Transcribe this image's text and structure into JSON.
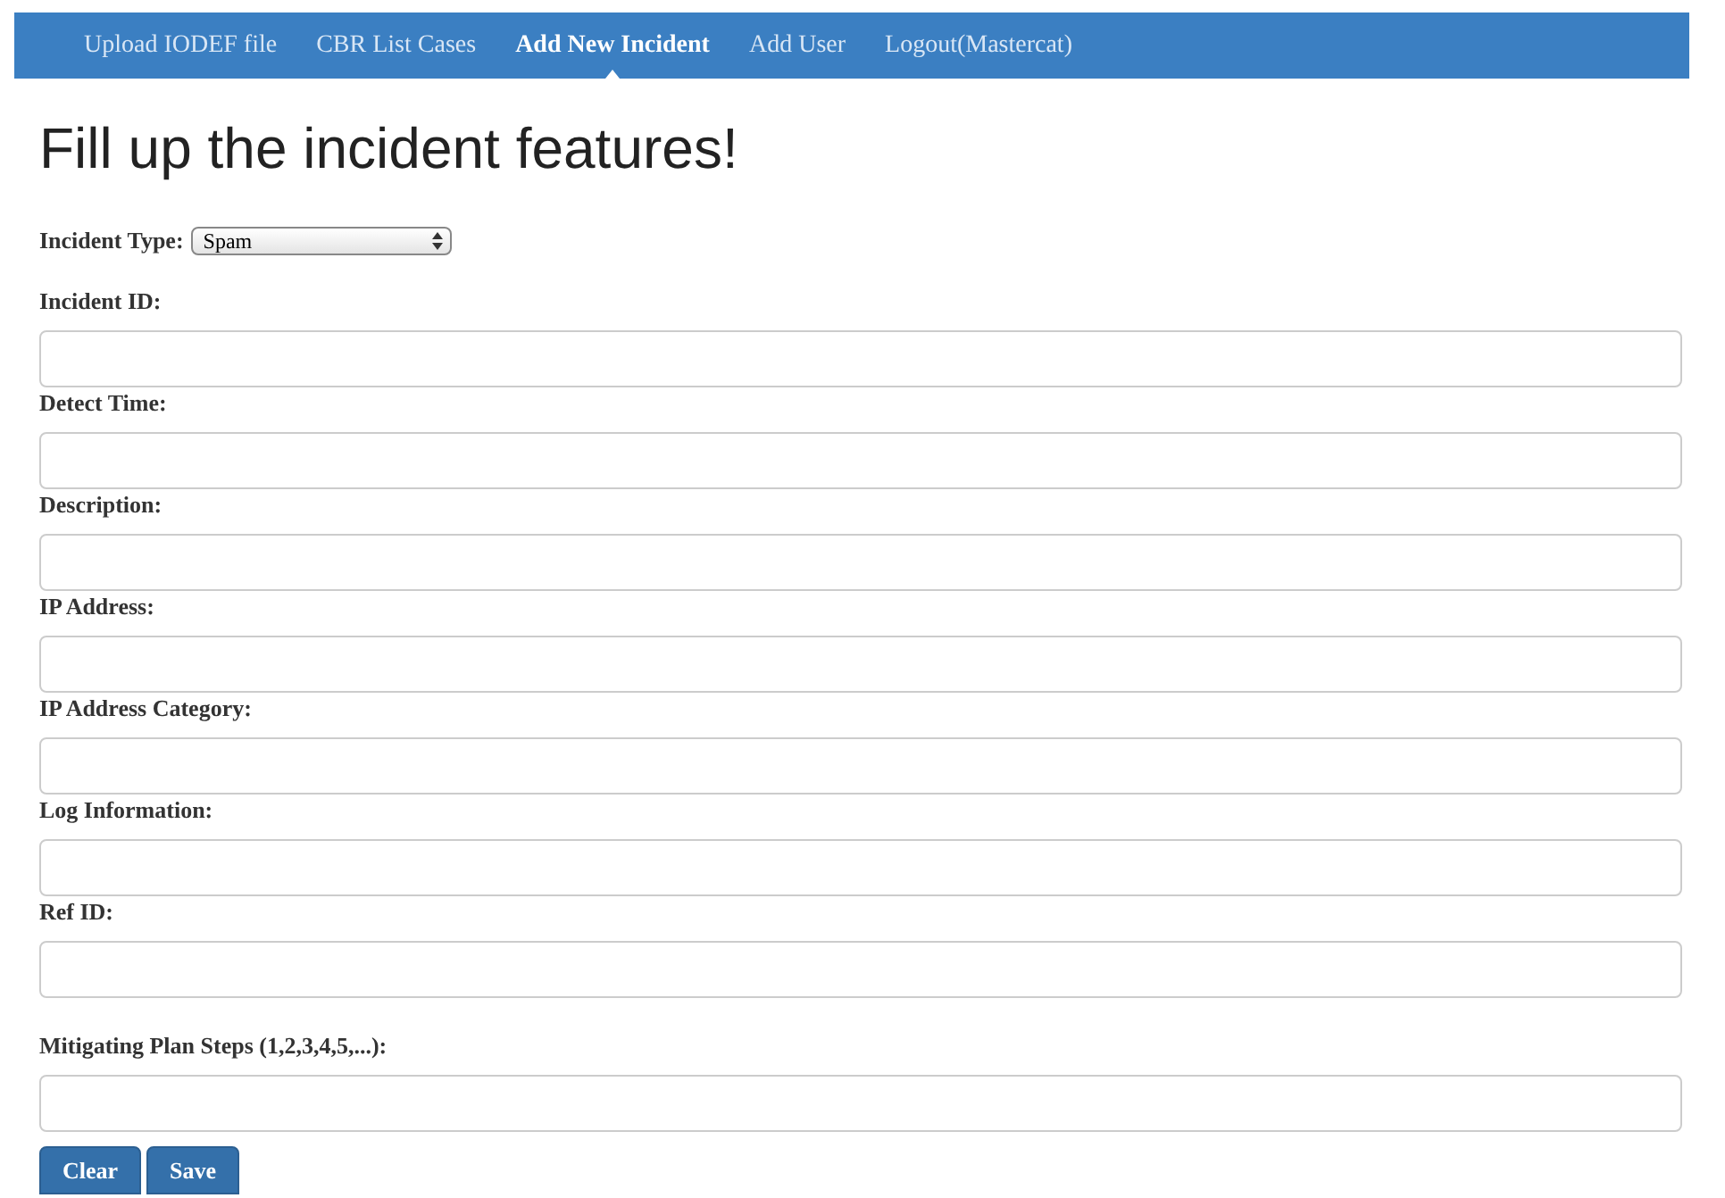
{
  "nav": [
    {
      "label": "Upload IODEF file",
      "selected": false
    },
    {
      "label": "CBR List Cases",
      "selected": false
    },
    {
      "label": "Add New Incident",
      "selected": true
    },
    {
      "label": "Add User",
      "selected": false
    },
    {
      "label": "Logout(Mastercat)",
      "selected": false
    }
  ],
  "heading": "Fill up the incident features!",
  "incident_type": {
    "label": "Incident Type:",
    "value": "Spam"
  },
  "fields": [
    {
      "label": "Incident ID:"
    },
    {
      "label": "Detect Time:"
    },
    {
      "label": "Description:"
    },
    {
      "label": "IP Address:"
    },
    {
      "label": "IP Address Category:"
    },
    {
      "label": "Log Information:"
    },
    {
      "label": "Ref ID:"
    },
    {
      "label": "Mitigating Plan Steps (1,2,3,4,5,...):"
    }
  ],
  "buttons": [
    "Clear",
    "Save"
  ]
}
